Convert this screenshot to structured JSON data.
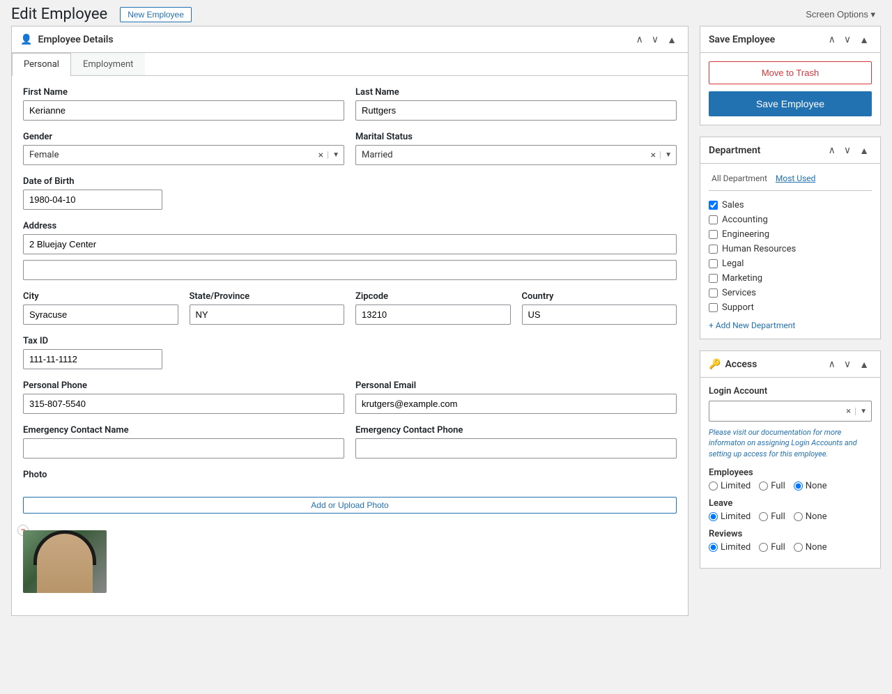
{
  "header": {
    "title": "Edit Employee",
    "new_employee_label": "New Employee",
    "screen_options_label": "Screen Options ▾"
  },
  "employee_details": {
    "card_title": "Employee Details",
    "tabs": [
      {
        "id": "personal",
        "label": "Personal",
        "active": true
      },
      {
        "id": "employment",
        "label": "Employment",
        "active": false
      }
    ],
    "fields": {
      "first_name_label": "First Name",
      "first_name_value": "Kerianne",
      "last_name_label": "Last Name",
      "last_name_value": "Ruttgers",
      "gender_label": "Gender",
      "gender_value": "Female",
      "marital_status_label": "Marital Status",
      "marital_status_value": "Married",
      "dob_label": "Date of Birth",
      "dob_value": "1980-04-10",
      "address_label": "Address",
      "address_line1": "2 Bluejay Center",
      "address_line2": "",
      "city_label": "City",
      "city_value": "Syracuse",
      "state_label": "State/Province",
      "state_value": "NY",
      "zip_label": "Zipcode",
      "zip_value": "13210",
      "country_label": "Country",
      "country_value": "US",
      "tax_id_label": "Tax ID",
      "tax_id_value": "111-11-1112",
      "phone_label": "Personal Phone",
      "phone_value": "315-807-5540",
      "email_label": "Personal Email",
      "email_value": "krutgers@example.com",
      "emergency_name_label": "Emergency Contact Name",
      "emergency_name_value": "",
      "emergency_phone_label": "Emergency Contact Phone",
      "emergency_phone_value": "",
      "photo_label": "Photo",
      "photo_btn_label": "Add or Upload Photo"
    }
  },
  "save_panel": {
    "title": "Save Employee",
    "trash_label": "Move to Trash",
    "save_label": "Save Employee"
  },
  "department_panel": {
    "title": "Department",
    "tab_all": "All Department",
    "tab_most_used": "Most Used",
    "departments": [
      {
        "name": "Sales",
        "checked": true
      },
      {
        "name": "Accounting",
        "checked": false
      },
      {
        "name": "Engineering",
        "checked": false
      },
      {
        "name": "Human Resources",
        "checked": false
      },
      {
        "name": "Legal",
        "checked": false
      },
      {
        "name": "Marketing",
        "checked": false
      },
      {
        "name": "Services",
        "checked": false
      },
      {
        "name": "Support",
        "checked": false
      }
    ],
    "add_dept_label": "+ Add New Department"
  },
  "access_panel": {
    "title": "Access",
    "login_account_label": "Login Account",
    "doc_link_text": "Please visit our documentation for more informaton on assigning Login Accounts and setting up access for this employee.",
    "groups": [
      {
        "label": "Employees",
        "options": [
          "Limited",
          "Full",
          "None"
        ],
        "selected": "None"
      },
      {
        "label": "Leave",
        "options": [
          "Limited",
          "Full",
          "None"
        ],
        "selected": "Limited"
      },
      {
        "label": "Reviews",
        "options": [
          "Limited",
          "Full",
          "None"
        ],
        "selected": "Limited"
      }
    ]
  }
}
